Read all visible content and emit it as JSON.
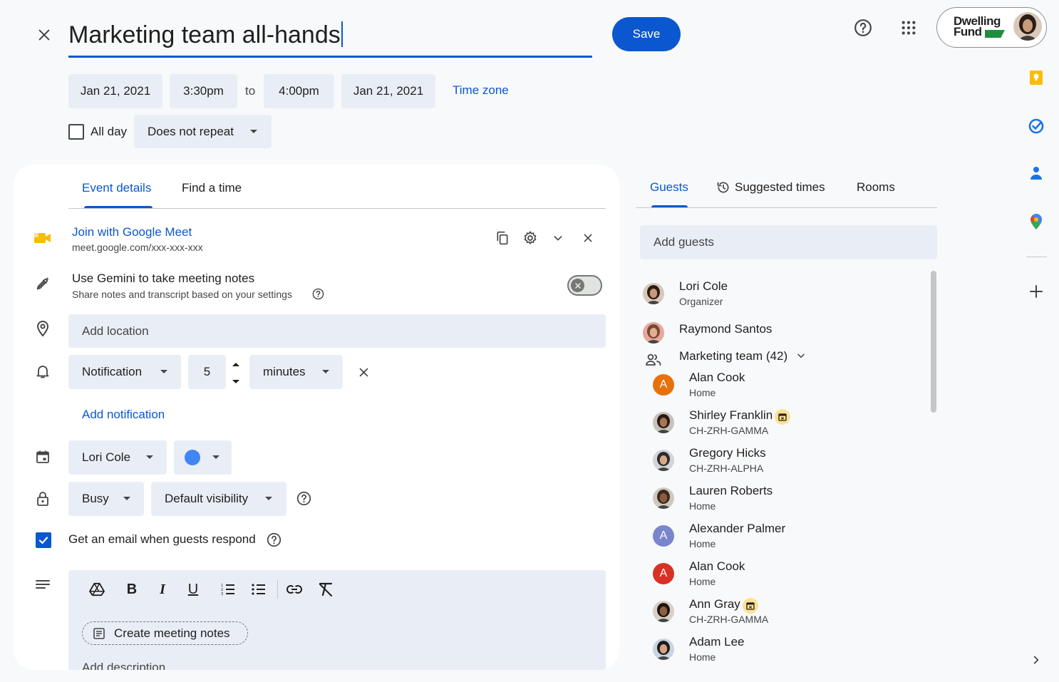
{
  "header": {
    "title": "Marketing team all-hands",
    "save_label": "Save",
    "brand_line1": "Dwelling",
    "brand_line2": "Fund"
  },
  "when": {
    "start_date": "Jan 21, 2021",
    "start_time": "3:30pm",
    "to": "to",
    "end_time": "4:00pm",
    "end_date": "Jan 21, 2021",
    "timezone": "Time zone",
    "all_day": "All day",
    "all_day_checked": false,
    "repeat": "Does not repeat"
  },
  "left_tabs": [
    "Event details",
    "Find a time"
  ],
  "meet": {
    "link": "Join with Google Meet",
    "url": "meet.google.com/xxx-xxx-xxx"
  },
  "gemini": {
    "title": "Use Gemini to take meeting notes",
    "subtitle": "Share notes and transcript based on your settings",
    "enabled": false
  },
  "location": {
    "placeholder": "Add location"
  },
  "notification": {
    "type": "Notification",
    "value": "5",
    "unit": "minutes",
    "add_label": "Add notification"
  },
  "calendar": {
    "owner": "Lori Cole",
    "color": "#4285f4"
  },
  "availability": {
    "status": "Busy",
    "visibility": "Default visibility"
  },
  "email": {
    "label": "Get an email when guests respond",
    "checked": true
  },
  "description": {
    "create_notes": "Create meeting notes",
    "placeholder": "Add description",
    "toolbar": [
      "drive-icon",
      "bold-icon",
      "italic-icon",
      "underline-icon",
      "numbered-list-icon",
      "bulleted-list-icon",
      "link-icon",
      "clear-format-icon"
    ]
  },
  "right_tabs": {
    "guests": "Guests",
    "suggested": "Suggested times",
    "rooms": "Rooms"
  },
  "guests_input": {
    "placeholder": "Add guests"
  },
  "guests": [
    {
      "name": "Lori Cole",
      "sub": "Organizer",
      "avatar": "photo",
      "indent": false,
      "badge": false
    },
    {
      "name": "Raymond Santos",
      "sub": "",
      "avatar": "photo",
      "indent": false,
      "badge": false
    },
    {
      "name": "Marketing team (42)",
      "sub": "",
      "avatar": "group",
      "indent": false,
      "badge": false
    },
    {
      "name": "Alan Cook",
      "sub": "Home",
      "avatar": "A",
      "color": "#e8710a",
      "indent": true,
      "badge": false
    },
    {
      "name": "Shirley Franklin",
      "sub": "CH-ZRH-GAMMA",
      "avatar": "photo",
      "indent": true,
      "badge": true
    },
    {
      "name": "Gregory Hicks",
      "sub": "CH-ZRH-ALPHA",
      "avatar": "photo",
      "indent": true,
      "badge": false
    },
    {
      "name": "Lauren Roberts",
      "sub": "Home",
      "avatar": "photo",
      "indent": true,
      "badge": false
    },
    {
      "name": "Alexander Palmer",
      "sub": "Home",
      "avatar": "A",
      "color": "#7986cb",
      "indent": true,
      "badge": false
    },
    {
      "name": "Alan Cook",
      "sub": "Home",
      "avatar": "A",
      "color": "#d93025",
      "indent": true,
      "badge": false
    },
    {
      "name": "Ann Gray",
      "sub": "CH-ZRH-GAMMA",
      "avatar": "photo",
      "indent": true,
      "badge": true
    },
    {
      "name": "Adam Lee",
      "sub": "Home",
      "avatar": "photo",
      "indent": true,
      "badge": false
    }
  ],
  "colors": {
    "accent": "#0b57d0",
    "chip_bg": "#e9eef6"
  }
}
